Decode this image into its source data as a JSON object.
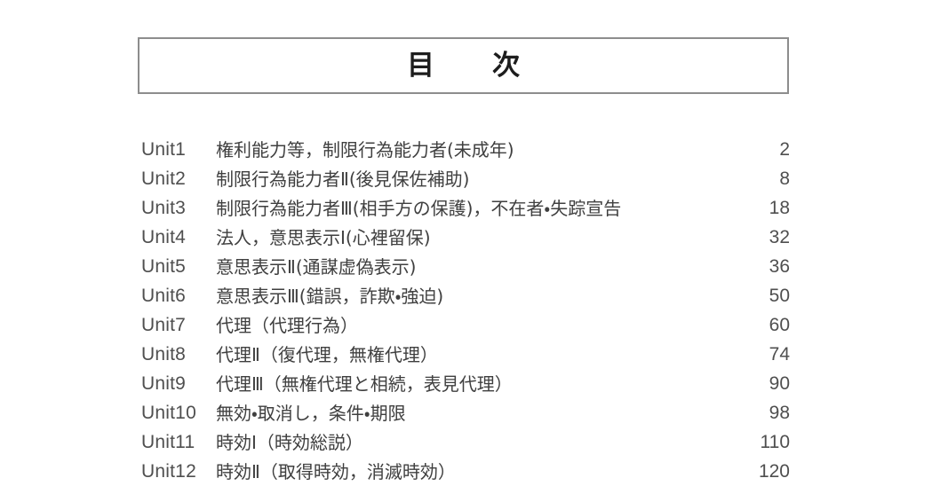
{
  "document": {
    "title_box": {
      "text": "目　次"
    },
    "toc": {
      "entries": [
        {
          "unit": "Unit1",
          "title": "権利能力等，制限行為能力者(未成年)",
          "page": "2"
        },
        {
          "unit": "Unit2",
          "title": "制限行為能力者Ⅱ(後見保佐補助)",
          "page": "8"
        },
        {
          "unit": "Unit3",
          "title": "制限行為能力者Ⅲ(相手方の保護)，不在者・失踪宣告",
          "page": "18"
        },
        {
          "unit": "Unit4",
          "title": "法人，意思表示Ⅰ(心裡留保)",
          "page": "32"
        },
        {
          "unit": "Unit5",
          "title": "意思表示Ⅱ(通謀虚偽表示)",
          "page": "36"
        },
        {
          "unit": "Unit6",
          "title": "意思表示Ⅲ(錯誤，詐欺・強迫)",
          "page": "50"
        },
        {
          "unit": "Unit7",
          "title": "代理（代理行為）",
          "page": "60"
        },
        {
          "unit": "Unit8",
          "title": "代理Ⅱ（復代理，無権代理）",
          "page": "74"
        },
        {
          "unit": "Unit9",
          "title": "代理Ⅲ（無権代理と相続，表見代理）",
          "page": "90"
        },
        {
          "unit": "Unit10",
          "title": "無効・取消し，条件・期限",
          "page": "98"
        },
        {
          "unit": "Unit11",
          "title": "時効Ⅰ（時効総説）",
          "page": "110"
        },
        {
          "unit": "Unit12",
          "title": "時効Ⅱ（取得時効，消滅時効）",
          "page": "120"
        }
      ]
    }
  }
}
